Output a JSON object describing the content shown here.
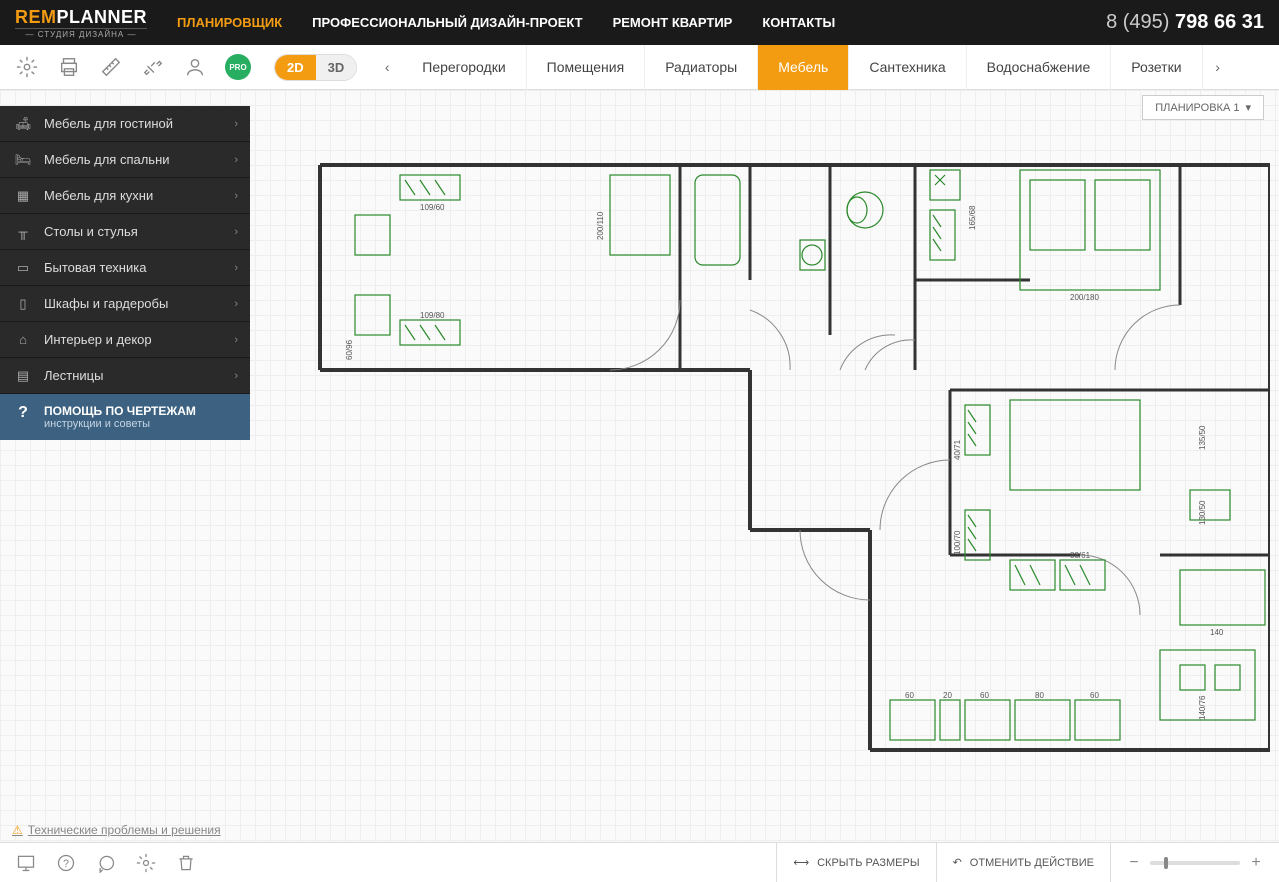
{
  "logo": {
    "brand_a": "REM",
    "brand_b": "PLANNER",
    "tagline": "— СТУДИЯ ДИЗАЙНА —"
  },
  "nav": [
    {
      "label": "ПЛАНИРОВЩИК",
      "active": true
    },
    {
      "label": "ПРОФЕССИОНАЛЬНЫЙ ДИЗАЙН-ПРОЕКТ",
      "active": false
    },
    {
      "label": "РЕМОНТ КВАРТИР",
      "active": false
    },
    {
      "label": "КОНТАКТЫ",
      "active": false
    }
  ],
  "phone": {
    "prefix": "8 (495) ",
    "number": "798 66 31"
  },
  "pro_badge": "PRO",
  "view": {
    "d2": "2D",
    "d3": "3D"
  },
  "tabs": [
    {
      "label": "Перегородки",
      "active": false
    },
    {
      "label": "Помещения",
      "active": false
    },
    {
      "label": "Радиаторы",
      "active": false
    },
    {
      "label": "Мебель",
      "active": true
    },
    {
      "label": "Сантехника",
      "active": false
    },
    {
      "label": "Водоснабжение",
      "active": false
    },
    {
      "label": "Розетки",
      "active": false
    }
  ],
  "plan_dropdown": "ПЛАНИРОВКА 1",
  "sidebar": {
    "items": [
      {
        "label": "Мебель для гостиной",
        "icon": "sofa"
      },
      {
        "label": "Мебель для спальни",
        "icon": "bed"
      },
      {
        "label": "Мебель для кухни",
        "icon": "kitchen"
      },
      {
        "label": "Столы и стулья",
        "icon": "table"
      },
      {
        "label": "Бытовая техника",
        "icon": "tv"
      },
      {
        "label": "Шкафы и гардеробы",
        "icon": "wardrobe"
      },
      {
        "label": "Интерьер и декор",
        "icon": "decor"
      },
      {
        "label": "Лестницы",
        "icon": "stairs"
      }
    ],
    "help": {
      "title": "ПОМОЩЬ ПО ЧЕРТЕЖАМ",
      "subtitle": "инструкции и советы"
    }
  },
  "floorplan_labels": {
    "dim1": "109/60",
    "dim2": "109/80",
    "dim3": "60/96",
    "dim4": "200/110",
    "dim5": "165/68",
    "dim6": "200/180",
    "dim7": "40/71",
    "dim8": "135/50",
    "dim9": "130/50",
    "dim10": "100/70",
    "dim11": "88/61",
    "dim12": "140",
    "dim13": "60",
    "dim14": "20",
    "dim15": "60",
    "dim16": "80",
    "dim17": "60",
    "dim18": "140/76"
  },
  "tech_link": "Технические проблемы и решения",
  "footer": {
    "hide_sizes": "СКРЫТЬ РАЗМЕРЫ",
    "undo": "ОТМЕНИТЬ ДЕЙСТВИЕ"
  }
}
